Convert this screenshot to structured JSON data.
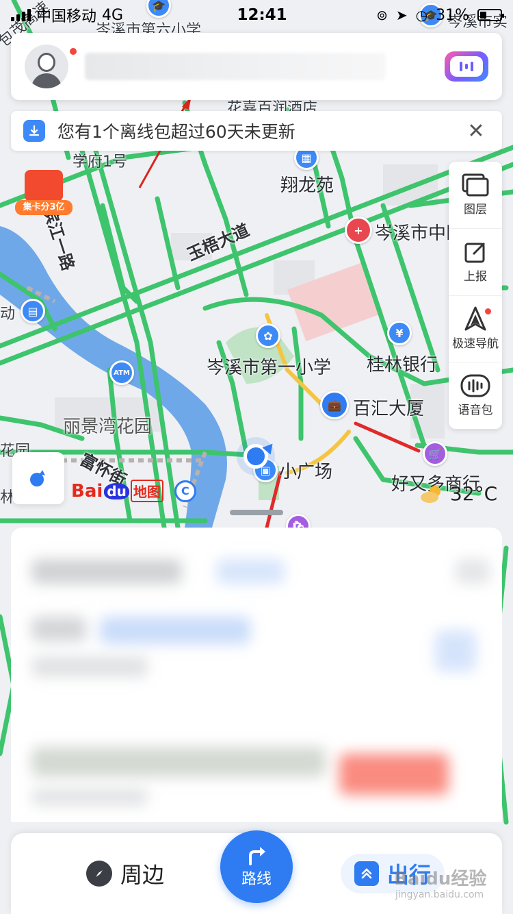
{
  "status_bar": {
    "carrier": "中国移动",
    "network": "4G",
    "time": "12:41",
    "battery": "31%"
  },
  "search": {
    "placeholder": ""
  },
  "notice": {
    "text": "您有1个离线包超过60天未更新",
    "close": "✕"
  },
  "map": {
    "labels": {
      "school6": "岑溪市第六小学",
      "road_top": "包茂高速",
      "hotel": "花嘉百润酒店",
      "xuefu": "学府1号",
      "xianglong": "翔龙苑",
      "hospital": "岑溪市中医",
      "wutong": "玉梧大道",
      "binjiang": "滨江一路",
      "school1": "岑溪市第一小学",
      "guilin_bank": "桂林银行",
      "baihui": "百汇大厦",
      "lijing": "丽景湾花园",
      "fuhuan": "富怀街",
      "square": "小广场",
      "haoyouduo": "好又多商行",
      "dong": "动",
      "yuan": "花园",
      "lin": "林",
      "cenxi_right": "岑溪市实",
      "promo": "集卡分3亿"
    },
    "pins": {
      "atm": "ATM",
      "bank": "¥",
      "hospital": "+"
    }
  },
  "toolbar": {
    "layers": "图层",
    "report": "上报",
    "fast_nav": "极速导航",
    "voice_pack": "语音包"
  },
  "logo": {
    "bai": "Bai",
    "du": "du",
    "ditu": "地图"
  },
  "weather": {
    "temp": "32°C"
  },
  "tabs": {
    "nearby": "周边",
    "route": "路线",
    "travel": "出行"
  },
  "watermark": {
    "main": "Baidu经验",
    "sub": "jingyan.baidu.com"
  },
  "colors": {
    "road_green": "#3ec46d",
    "road_red": "#e02a2a",
    "road_yellow": "#f5c542",
    "river": "#6fa8e8",
    "accent_blue": "#2f7cf2"
  }
}
